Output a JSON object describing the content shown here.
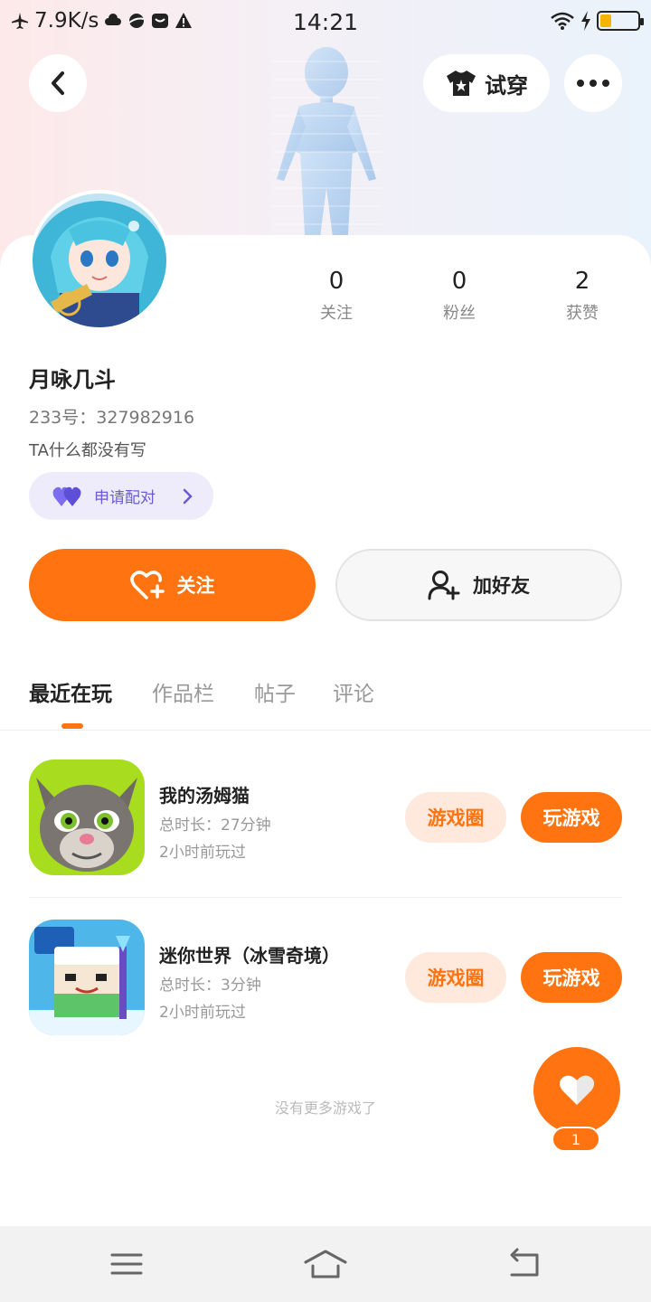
{
  "status_bar": {
    "speed": "7.9K/s",
    "time": "14:21",
    "battery_level": 0.3,
    "battery_color": "#f5b400"
  },
  "header": {
    "back_icon": "chevron-left-icon",
    "try_on_label": "试穿",
    "try_on_icon": "shirt-icon",
    "more_icon": "more-dots-icon"
  },
  "profile": {
    "name": "月咏几斗",
    "id_text": "233号：327982916",
    "bio": "TA什么都没有写",
    "pair_label": "申请配对",
    "stats": [
      {
        "value": "0",
        "label": "关注"
      },
      {
        "value": "0",
        "label": "粉丝"
      },
      {
        "value": "2",
        "label": "获赞"
      }
    ]
  },
  "actions": {
    "follow_label": "关注",
    "add_friend_label": "加好友"
  },
  "tabs": [
    {
      "label": "最近在玩",
      "active": true
    },
    {
      "label": "作品栏",
      "active": false
    },
    {
      "label": "帖子",
      "active": false
    },
    {
      "label": "评论",
      "active": false
    }
  ],
  "games": [
    {
      "title": "我的汤姆猫",
      "duration": "总时长：27分钟",
      "last_played": "2小时前玩过",
      "circle_label": "游戏圈",
      "play_label": "玩游戏"
    },
    {
      "title": "迷你世界（冰雪奇境）",
      "duration": "总时长：3分钟",
      "last_played": "2小时前玩过",
      "circle_label": "游戏圈",
      "play_label": "玩游戏"
    }
  ],
  "footer_text": "没有更多游戏了",
  "like": {
    "count": "1"
  },
  "colors": {
    "accent": "#ff7410",
    "accent_light": "#ffe9dd",
    "pair_bg": "#eeebfb",
    "pair_text": "#6a5ad8"
  }
}
